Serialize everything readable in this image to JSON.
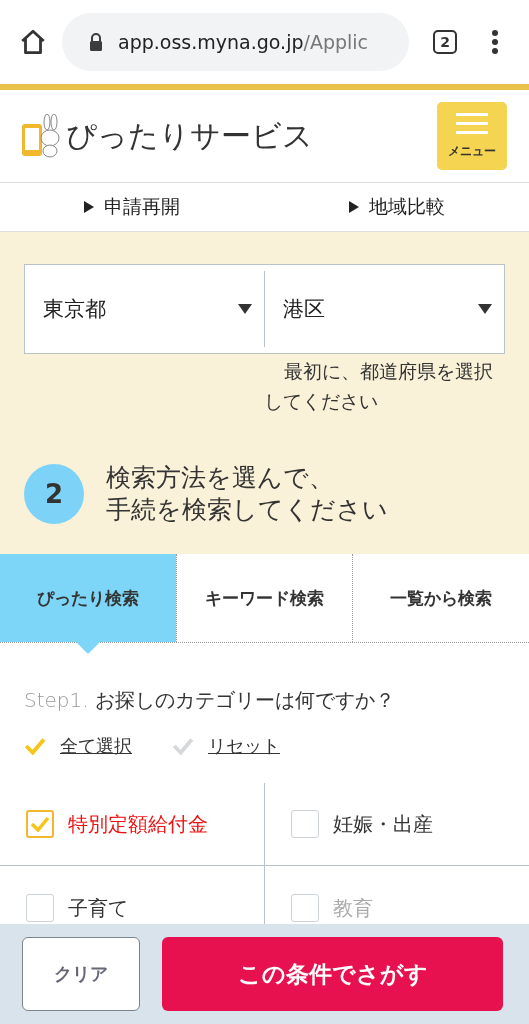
{
  "browser": {
    "url_host": "app.oss.myna.go.jp",
    "url_path": "/Applic",
    "tab_count": "2"
  },
  "header": {
    "title": "ぴったりサービス",
    "menu_label": "メニュー"
  },
  "nav_links": [
    "申請再開",
    "地域比較"
  ],
  "region": {
    "prefecture": "東京都",
    "city": "港区",
    "hint": "最初に、都道府県を選択してください"
  },
  "step2": {
    "number": "2",
    "heading_lines": [
      "検索方法を選んで、",
      "手続を検索してください"
    ]
  },
  "tabs": [
    {
      "label": "ぴったり検索",
      "selected": true
    },
    {
      "label": "キーワード検索",
      "selected": false
    },
    {
      "label": "一覧から検索",
      "selected": false
    }
  ],
  "step1": {
    "prefix": "Step1.",
    "question": "お探しのカテゴリーは何ですか？"
  },
  "actions": [
    {
      "label": "全て選択",
      "highlighted": true
    },
    {
      "label": "リセット",
      "highlighted": false
    }
  ],
  "categories": [
    {
      "label": "特別定額給付金",
      "checked": true,
      "disabled": false
    },
    {
      "label": "妊娠・出産",
      "checked": false,
      "disabled": false
    },
    {
      "label": "子育て",
      "checked": false,
      "disabled": false
    },
    {
      "label": "教育",
      "checked": false,
      "disabled": true
    }
  ],
  "footer": {
    "clear_label": "クリア",
    "search_label": "この条件でさがす"
  }
}
